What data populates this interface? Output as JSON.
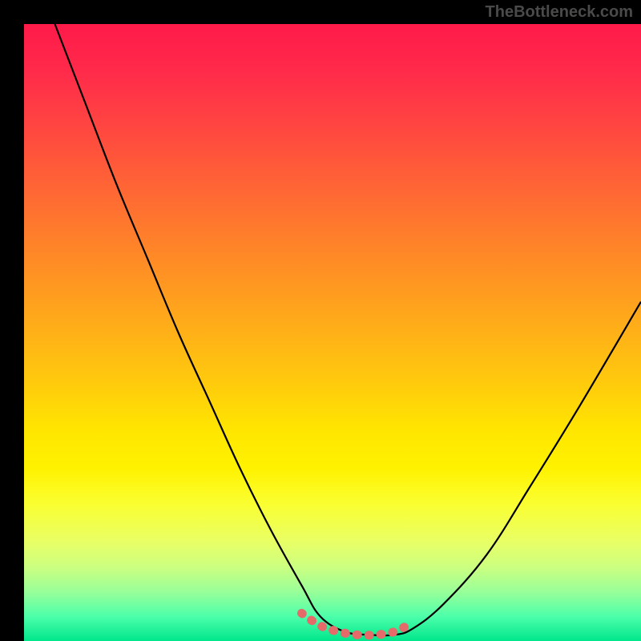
{
  "attribution": "TheBottleneck.com",
  "chart_data": {
    "type": "line",
    "title": "",
    "xlabel": "",
    "ylabel": "",
    "xlim": [
      0,
      100
    ],
    "ylim": [
      0,
      100
    ],
    "grid": false,
    "description": "Bottleneck curve: steep descent from top-left, flat minimum around x=50-60, rise toward right. Background gradient red (top, high bottleneck) to green (bottom, low bottleneck).",
    "series": [
      {
        "name": "curve",
        "color": "#000000",
        "x": [
          5,
          10,
          15,
          20,
          25,
          30,
          35,
          40,
          45,
          48,
          52,
          56,
          60,
          63,
          68,
          75,
          82,
          90,
          100
        ],
        "y": [
          100,
          87,
          74,
          62,
          50,
          39,
          28,
          18,
          9,
          4,
          1.5,
          1,
          1,
          2,
          6,
          14,
          25,
          38,
          55
        ]
      },
      {
        "name": "highlight",
        "color": "#e56a6a",
        "x": [
          45,
          48,
          51,
          54,
          57,
          60,
          63
        ],
        "y": [
          4.5,
          2.5,
          1.5,
          1,
          1,
          1.5,
          3
        ]
      }
    ],
    "gradient_stops": [
      {
        "pos": 0,
        "color": "#ff1a4a"
      },
      {
        "pos": 50,
        "color": "#ffca0d"
      },
      {
        "pos": 75,
        "color": "#fff200"
      },
      {
        "pos": 100,
        "color": "#00e68c"
      }
    ]
  }
}
